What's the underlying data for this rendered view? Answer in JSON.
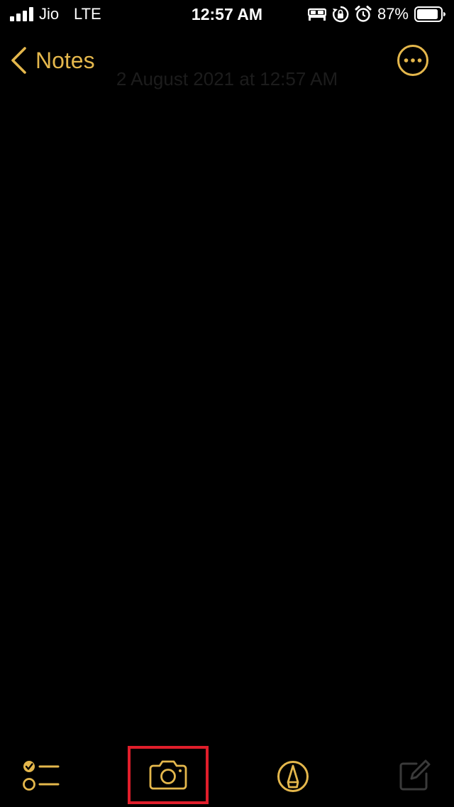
{
  "status_bar": {
    "carrier": "Jio",
    "network": "LTE",
    "time": "12:57 AM",
    "battery_percent": "87%",
    "icons": [
      "signal-icon",
      "bed-icon",
      "orientation-lock-icon",
      "alarm-icon",
      "battery-icon"
    ]
  },
  "nav": {
    "back_label": "Notes",
    "back_icon": "chevron-left-icon",
    "more_icon": "ellipsis-circle-icon"
  },
  "note": {
    "date": "2 August 2021 at 12:57 AM",
    "body": ""
  },
  "toolbar": {
    "items": [
      {
        "name": "checklist",
        "icon": "checklist-icon"
      },
      {
        "name": "camera",
        "icon": "camera-icon",
        "highlighted": true
      },
      {
        "name": "markup",
        "icon": "markup-pen-icon"
      },
      {
        "name": "compose",
        "icon": "compose-icon",
        "disabled": true
      }
    ]
  },
  "colors": {
    "accent": "#E4B74C",
    "background": "#000000",
    "highlight": "#E01E2B",
    "disabled": "#3a3a3a"
  }
}
